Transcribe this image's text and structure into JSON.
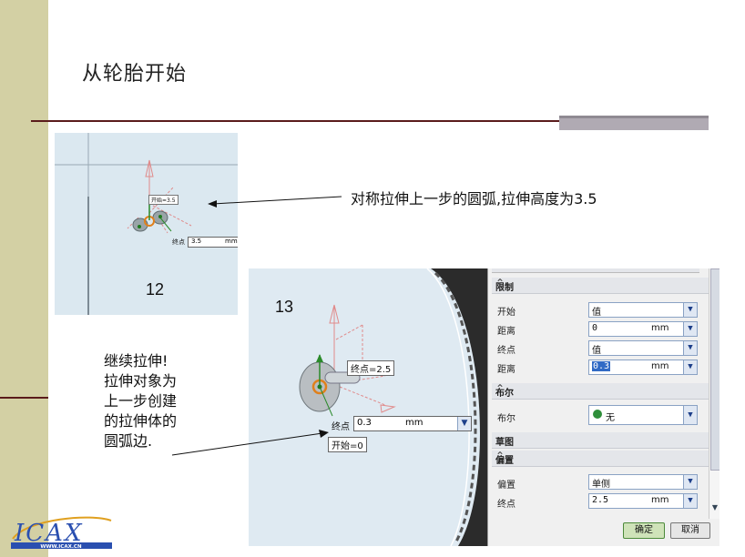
{
  "slide": {
    "title": "从轮胎开始",
    "callout_right": "对称拉伸上一步的圆弧,拉伸高度为3.5",
    "callout_left": "继续拉伸!拉伸对象为上一步创建的拉伸体的圆弧边.",
    "label_12": "12",
    "label_13": "13"
  },
  "shot12": {
    "start_label": "开始=3.5",
    "end_label": "终点",
    "end_value": "3.5",
    "end_unit": "mm"
  },
  "shot13": {
    "viewport": {
      "end_tag": "终点=2.5",
      "end_label": "终点",
      "end_value": "0.3",
      "end_unit": "mm",
      "start_tag": "开始=0"
    },
    "panel": {
      "limits": {
        "header": "限制",
        "start_label": "开始",
        "start_value": "值",
        "distance1_label": "距离",
        "distance1_value": "0",
        "distance1_unit": "mm",
        "end_label": "终点",
        "end_value": "值",
        "distance2_label": "距离",
        "distance2_value": "0.3",
        "distance2_unit": "mm"
      },
      "boolean": {
        "header": "布尔",
        "label": "布尔",
        "value": "无"
      },
      "sketch": {
        "header": "草图"
      },
      "offset": {
        "header": "偏置",
        "offset_label": "偏置",
        "offset_value": "单侧",
        "end_label": "终点",
        "end_value": "2.5",
        "end_unit": "mm"
      },
      "ok_label": "确定",
      "cancel_label": "取消"
    }
  },
  "logo": {
    "text": "ICAX",
    "url_text": "WWW.ICAX.CN"
  },
  "colors": {
    "sidebar": "#d3d0a4",
    "rule": "#5a1b1b",
    "accent_block": "#b0aab3",
    "logo_blue": "#2a4fb0",
    "highlight": "#316ac5"
  }
}
